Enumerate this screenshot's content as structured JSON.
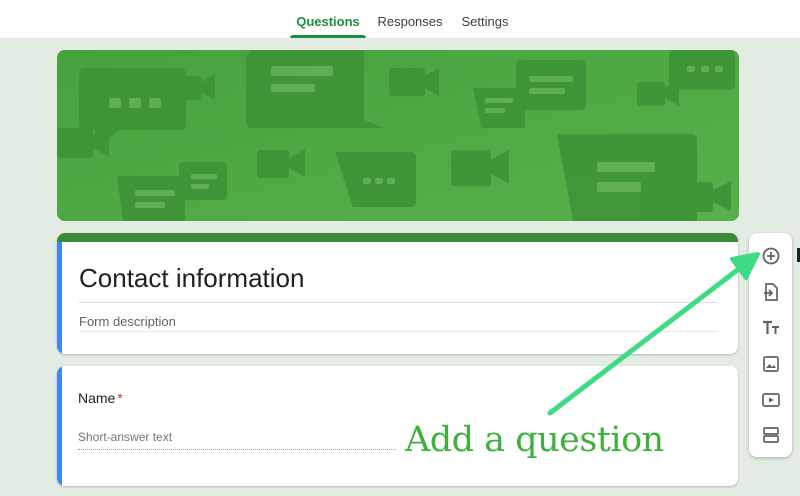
{
  "tabs": [
    {
      "label": "Questions",
      "active": true
    },
    {
      "label": "Responses",
      "active": false
    },
    {
      "label": "Settings",
      "active": false
    }
  ],
  "form": {
    "title": "Contact information",
    "description_placeholder": "Form description"
  },
  "question": {
    "label": "Name",
    "required_marker": "*",
    "answer_placeholder": "Short-answer text"
  },
  "toolbar": {
    "items": [
      {
        "icon": "add-circle-icon"
      },
      {
        "icon": "import-question-icon"
      },
      {
        "icon": "title-text-icon"
      },
      {
        "icon": "image-icon"
      },
      {
        "icon": "video-icon"
      },
      {
        "icon": "section-icon"
      }
    ]
  },
  "annotation": {
    "text": "Add a question"
  },
  "colors": {
    "accent": "#1e8e3e",
    "banner": "#4ea844",
    "theme_stripe": "#3b8a37",
    "focus_stripe": "#4285f4",
    "annotation": "#3cb23c",
    "required": "#d93025"
  }
}
